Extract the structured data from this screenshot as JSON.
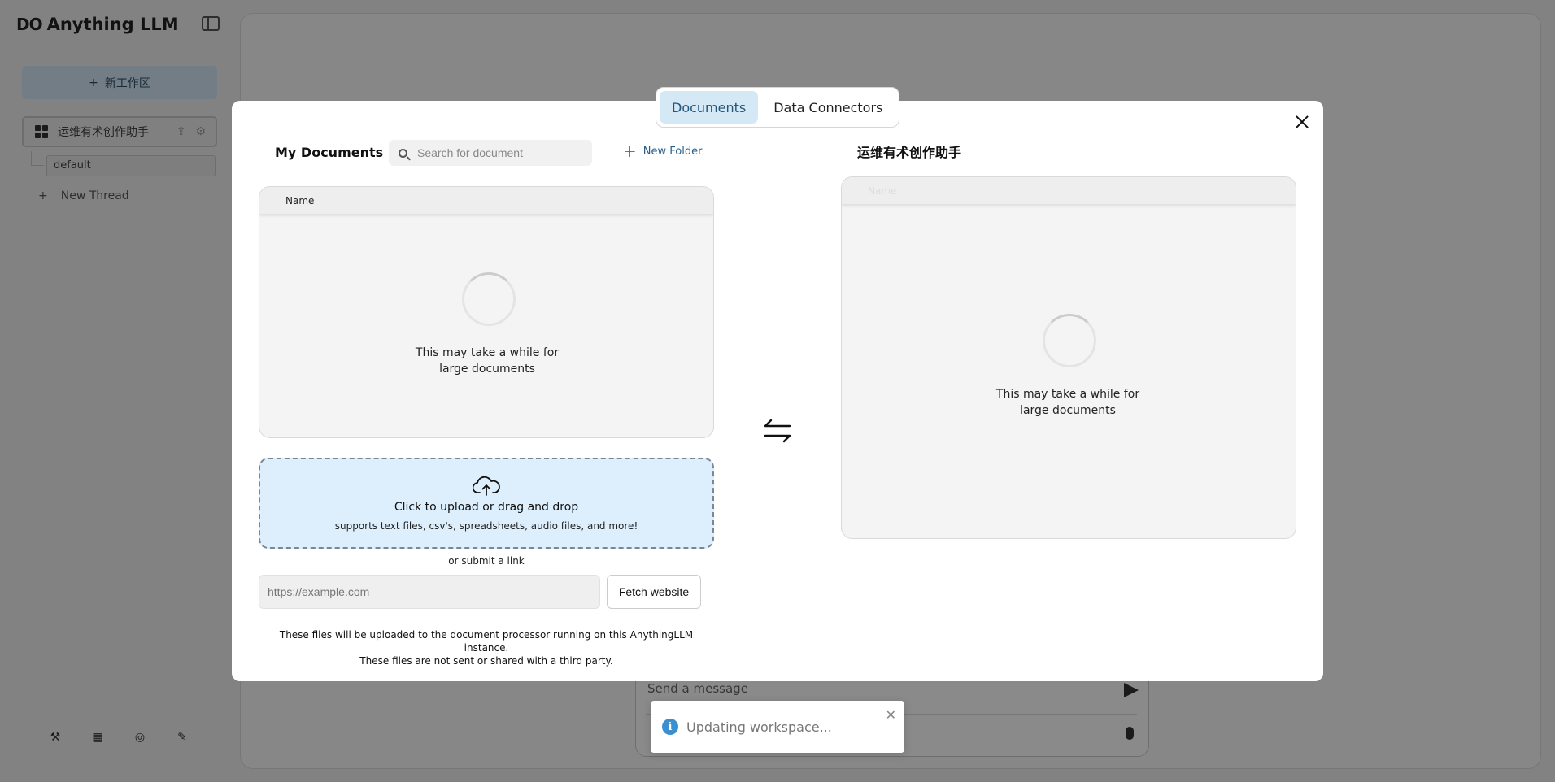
{
  "app": {
    "brand": "Anything LLM",
    "brand_logo": "DO"
  },
  "sidebar": {
    "new_workspace_label": "新工作区",
    "workspace": {
      "name": "运维有术创作助手"
    },
    "thread": {
      "name": "default"
    },
    "new_thread_label": "New Thread"
  },
  "composer": {
    "placeholder": "Send a message"
  },
  "modal": {
    "tabs": [
      {
        "label": "Documents",
        "active": true
      },
      {
        "label": "Data Connectors",
        "active": false
      }
    ],
    "my_documents": {
      "title": "My Documents",
      "search_placeholder": "Search for document",
      "new_folder_label": "New Folder",
      "table_header": "Name",
      "loading_line1": "This may take a while for",
      "loading_line2": "large documents"
    },
    "upload": {
      "title": "Click to upload or drag and drop",
      "subtitle": "supports text files, csv's, spreadsheets, audio files, and more!",
      "or_link": "or submit a link",
      "url_placeholder": "https://example.com",
      "fetch_label": "Fetch website",
      "disclaimer_line1": "These files will be uploaded to the document processor running on this AnythingLLM instance.",
      "disclaimer_line2": "These files are not sent or shared with a third party."
    },
    "workspace_docs": {
      "title": "运维有术创作助手",
      "table_header": "Name",
      "loading_line1": "This may take a while for",
      "loading_line2": "large documents"
    }
  },
  "toast": {
    "message": "Updating workspace...",
    "accent": "#3a8fd1"
  },
  "colors": {
    "accent_blue": "#d4e9f5",
    "upload_bg": "#ddeffc"
  }
}
